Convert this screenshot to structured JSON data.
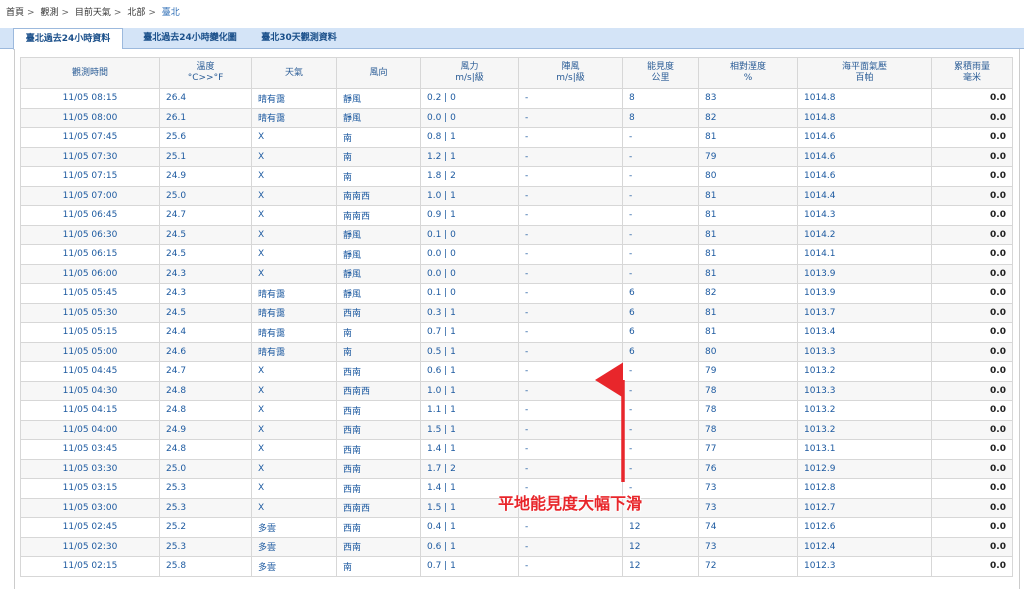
{
  "breadcrumb": {
    "items": [
      "首頁",
      "觀測",
      "目前天氣",
      "北部"
    ],
    "current": "臺北",
    "separator": ">"
  },
  "tabs": [
    {
      "label": "臺北過去24小時資料",
      "active": true
    },
    {
      "label": "臺北過去24小時變化圖",
      "active": false
    },
    {
      "label": "臺北30天觀測資料",
      "active": false
    }
  ],
  "table": {
    "headers": [
      [
        "觀測時間",
        ""
      ],
      [
        "溫度",
        "°C>>°F"
      ],
      [
        "天氣",
        ""
      ],
      [
        "風向",
        ""
      ],
      [
        "風力",
        "m/s|級"
      ],
      [
        "陣風",
        "m/s|級"
      ],
      [
        "能見度",
        "公里"
      ],
      [
        "相對溼度",
        "%"
      ],
      [
        "海平面氣壓",
        "百帕"
      ],
      [
        "累積雨量",
        "毫米"
      ]
    ],
    "rows": [
      [
        "11/05 08:15",
        "26.4",
        "晴有靄",
        "靜風",
        "0.2 | 0",
        "-",
        "8",
        "83",
        "1014.8",
        "0.0"
      ],
      [
        "11/05 08:00",
        "26.1",
        "晴有靄",
        "靜風",
        "0.0 | 0",
        "-",
        "8",
        "82",
        "1014.8",
        "0.0"
      ],
      [
        "11/05 07:45",
        "25.6",
        "X",
        "南",
        "0.8 | 1",
        "-",
        "-",
        "81",
        "1014.6",
        "0.0"
      ],
      [
        "11/05 07:30",
        "25.1",
        "X",
        "南",
        "1.2 | 1",
        "-",
        "-",
        "79",
        "1014.6",
        "0.0"
      ],
      [
        "11/05 07:15",
        "24.9",
        "X",
        "南",
        "1.8 | 2",
        "-",
        "-",
        "80",
        "1014.6",
        "0.0"
      ],
      [
        "11/05 07:00",
        "25.0",
        "X",
        "南南西",
        "1.0 | 1",
        "-",
        "-",
        "81",
        "1014.4",
        "0.0"
      ],
      [
        "11/05 06:45",
        "24.7",
        "X",
        "南南西",
        "0.9 | 1",
        "-",
        "-",
        "81",
        "1014.3",
        "0.0"
      ],
      [
        "11/05 06:30",
        "24.5",
        "X",
        "靜風",
        "0.1 | 0",
        "-",
        "-",
        "81",
        "1014.2",
        "0.0"
      ],
      [
        "11/05 06:15",
        "24.5",
        "X",
        "靜風",
        "0.0 | 0",
        "-",
        "-",
        "81",
        "1014.1",
        "0.0"
      ],
      [
        "11/05 06:00",
        "24.3",
        "X",
        "靜風",
        "0.0 | 0",
        "-",
        "-",
        "81",
        "1013.9",
        "0.0"
      ],
      [
        "11/05 05:45",
        "24.3",
        "晴有靄",
        "靜風",
        "0.1 | 0",
        "-",
        "6",
        "82",
        "1013.9",
        "0.0"
      ],
      [
        "11/05 05:30",
        "24.5",
        "晴有靄",
        "西南",
        "0.3 | 1",
        "-",
        "6",
        "81",
        "1013.7",
        "0.0"
      ],
      [
        "11/05 05:15",
        "24.4",
        "晴有靄",
        "南",
        "0.7 | 1",
        "-",
        "6",
        "81",
        "1013.4",
        "0.0"
      ],
      [
        "11/05 05:00",
        "24.6",
        "晴有靄",
        "南",
        "0.5 | 1",
        "-",
        "6",
        "80",
        "1013.3",
        "0.0"
      ],
      [
        "11/05 04:45",
        "24.7",
        "X",
        "西南",
        "0.6 | 1",
        "-",
        "-",
        "79",
        "1013.2",
        "0.0"
      ],
      [
        "11/05 04:30",
        "24.8",
        "X",
        "西南西",
        "1.0 | 1",
        "-",
        "-",
        "78",
        "1013.3",
        "0.0"
      ],
      [
        "11/05 04:15",
        "24.8",
        "X",
        "西南",
        "1.1 | 1",
        "-",
        "-",
        "78",
        "1013.2",
        "0.0"
      ],
      [
        "11/05 04:00",
        "24.9",
        "X",
        "西南",
        "1.5 | 1",
        "-",
        "-",
        "78",
        "1013.2",
        "0.0"
      ],
      [
        "11/05 03:45",
        "24.8",
        "X",
        "西南",
        "1.4 | 1",
        "-",
        "-",
        "77",
        "1013.1",
        "0.0"
      ],
      [
        "11/05 03:30",
        "25.0",
        "X",
        "西南",
        "1.7 | 2",
        "-",
        "-",
        "76",
        "1012.9",
        "0.0"
      ],
      [
        "11/05 03:15",
        "25.3",
        "X",
        "西南",
        "1.4 | 1",
        "-",
        "-",
        "73",
        "1012.8",
        "0.0"
      ],
      [
        "11/05 03:00",
        "25.3",
        "X",
        "西南西",
        "1.5 | 1",
        "-",
        "-",
        "73",
        "1012.7",
        "0.0"
      ],
      [
        "11/05 02:45",
        "25.2",
        "多雲",
        "西南",
        "0.4 | 1",
        "-",
        "12",
        "74",
        "1012.6",
        "0.0"
      ],
      [
        "11/05 02:30",
        "25.3",
        "多雲",
        "西南",
        "0.6 | 1",
        "-",
        "12",
        "73",
        "1012.4",
        "0.0"
      ],
      [
        "11/05 02:15",
        "25.8",
        "多雲",
        "南",
        "0.7 | 1",
        "-",
        "12",
        "72",
        "1012.3",
        "0.0"
      ]
    ]
  },
  "annotation": {
    "text": "平地能見度大幅下滑",
    "color": "#e8262b"
  }
}
